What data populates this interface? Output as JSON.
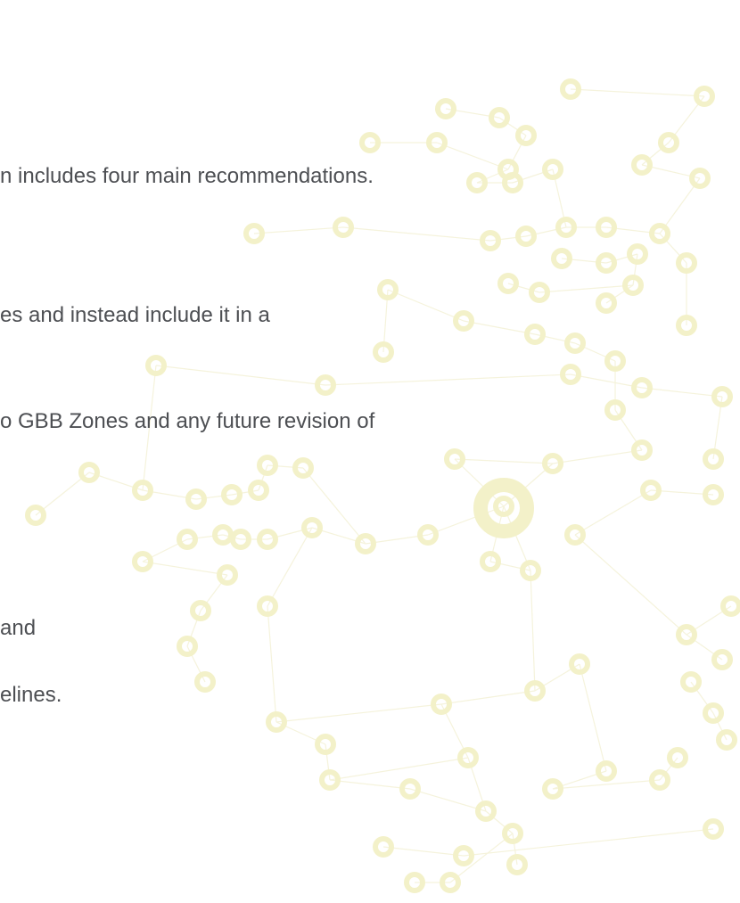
{
  "document": {
    "lines": [
      "n includes four main recommendations.",
      "es and instead include it in a",
      "o GBB Zones and any future revision of",
      "and",
      "elines."
    ]
  },
  "colors": {
    "text": "#4d4f53",
    "network_node": "#f3f1c9",
    "network_line": "#f5f3dc",
    "background": "#ffffff"
  }
}
